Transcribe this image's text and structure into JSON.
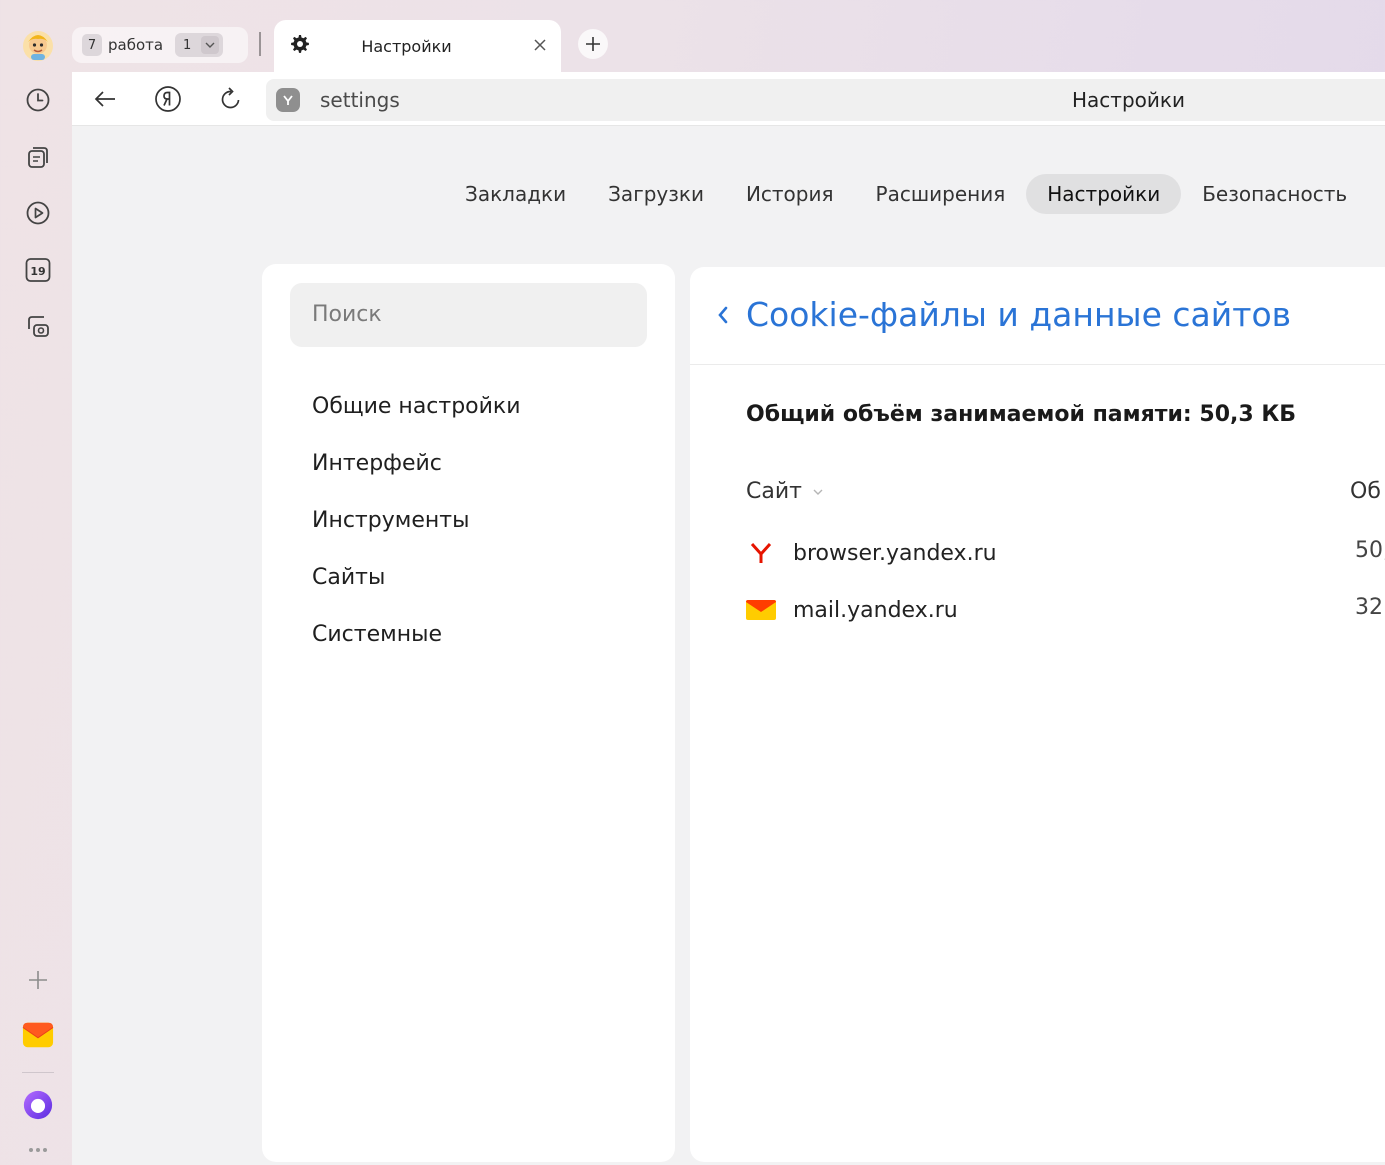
{
  "tab_strip": {
    "group_count": "7",
    "group_name": "работа",
    "group_badge": "1",
    "active_tab_title": "Настройки"
  },
  "address_bar": {
    "url": "settings",
    "page_title": "Настройки"
  },
  "top_nav": {
    "items": [
      "Закладки",
      "Загрузки",
      "История",
      "Расширения",
      "Настройки",
      "Безопасность"
    ],
    "active": "Настройки"
  },
  "sidebar": {
    "search_placeholder": "Поиск",
    "items": [
      "Общие настройки",
      "Интерфейс",
      "Инструменты",
      "Сайты",
      "Системные"
    ]
  },
  "left_rail": {
    "icons": [
      "profile-avatar-icon",
      "history-clock-icon",
      "collections-icon",
      "video-play-icon",
      "calendar-icon",
      "screenshot-icon",
      "add-icon",
      "mail-icon",
      "alice-assistant-icon",
      "more-icon"
    ],
    "calendar_day": "19"
  },
  "content": {
    "title": "Cookie-файлы и данные сайтов",
    "total_label": "Общий объём занимаемой памяти: 50,3 КБ",
    "columns": {
      "site": "Сайт",
      "size": "Об"
    },
    "rows": [
      {
        "site": "browser.yandex.ru",
        "size": "50,",
        "icon": "yandex-y-icon"
      },
      {
        "site": "mail.yandex.ru",
        "size": "32",
        "icon": "yandex-mail-icon"
      }
    ]
  },
  "colors": {
    "accent_link": "#2a74d6",
    "yandex_red": "#e61400",
    "mail_yellow": "#ffcc00",
    "alice_purple": "#7a3cf0"
  }
}
